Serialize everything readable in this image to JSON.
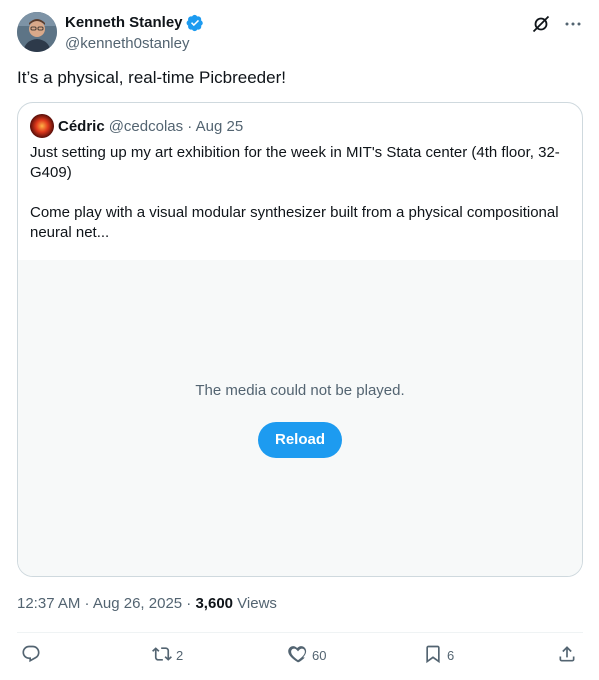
{
  "author": {
    "name": "Kenneth Stanley",
    "handle": "@kenneth0stanley"
  },
  "tweet": {
    "text": "It’s a physical, real-time Picbreeder!"
  },
  "quoted": {
    "name": "Cédric",
    "meta": "@cedcolas · Aug 25",
    "paragraphs": [
      "Just setting up my art exhibition for the week in MIT's Stata center (4th floor, 32-G409)",
      "Come play with a visual modular synthesizer built from a physical compositional neural net..."
    ],
    "media_message": "The media could not be played.",
    "reload_label": "Reload"
  },
  "timestamp": "12:37 AM · Aug 26, 2025 · ",
  "views_count": "3,600",
  "views_label": " Views",
  "actions": {
    "reply": "",
    "retweet": "2",
    "like": "60",
    "bookmark": "6"
  },
  "colors": {
    "accent": "#1d9bf0",
    "secondary_text": "#536471",
    "border": "#cfd9de"
  },
  "icons": [
    "verified-badge-icon",
    "grok-icon",
    "more-icon",
    "reply-icon",
    "retweet-icon",
    "like-icon",
    "bookmark-icon",
    "share-icon"
  ]
}
